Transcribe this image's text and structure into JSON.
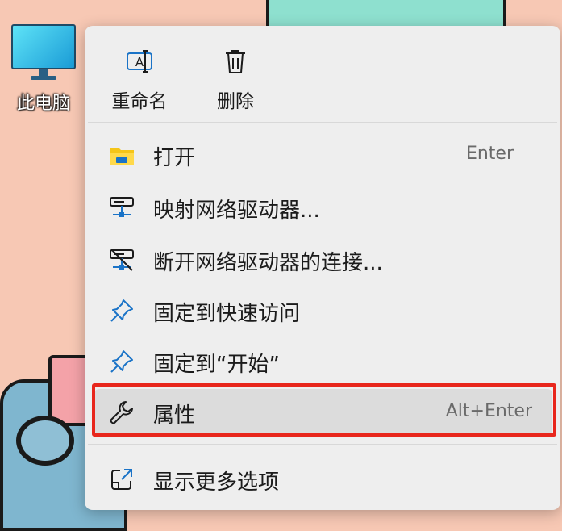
{
  "desktop": {
    "icon_label": "此电脑",
    "icon_name": "computer-monitor-icon"
  },
  "menu": {
    "quick_actions": [
      {
        "label": "重命名",
        "icon": "rename-icon"
      },
      {
        "label": "删除",
        "icon": "trash-icon"
      }
    ],
    "items": [
      {
        "label": "打开",
        "shortcut": "Enter",
        "icon": "folder-icon"
      },
      {
        "label": "映射网络驱动器...",
        "shortcut": "",
        "icon": "network-drive-icon"
      },
      {
        "label": "断开网络驱动器的连接...",
        "shortcut": "",
        "icon": "disconnect-drive-icon"
      },
      {
        "label": "固定到快速访问",
        "shortcut": "",
        "icon": "pin-icon"
      },
      {
        "label": "固定到“开始”",
        "shortcut": "",
        "icon": "pin-icon"
      },
      {
        "label": "属性",
        "shortcut": "Alt+Enter",
        "icon": "wrench-icon"
      }
    ],
    "footer_item": {
      "label": "显示更多选项",
      "icon": "open-external-icon"
    }
  },
  "colors": {
    "highlight_border": "#e8261c",
    "menu_bg": "#eeeeee",
    "icon_blue": "#1a73c7"
  }
}
